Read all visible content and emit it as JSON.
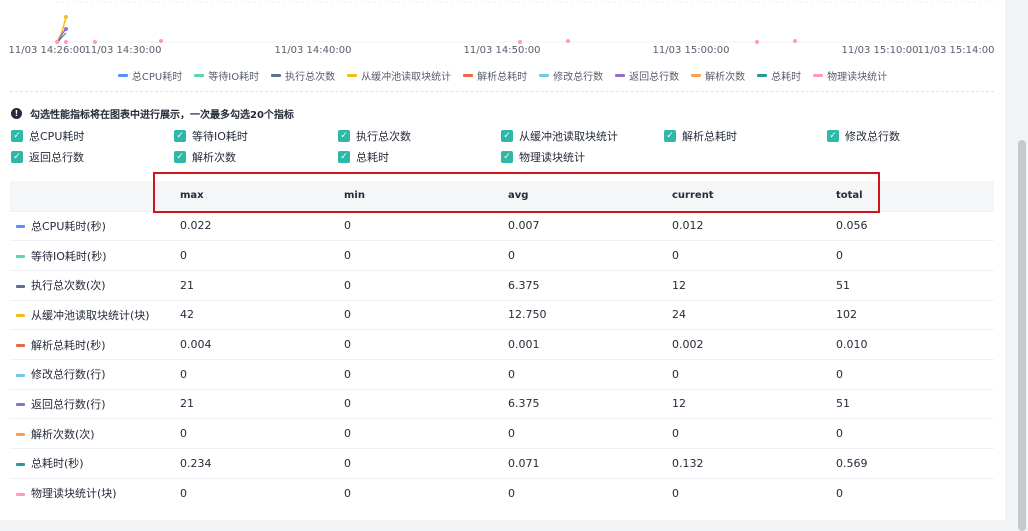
{
  "chart": {
    "x_ticks": [
      "11/03 14:26:00",
      "11/03 14:30:00",
      "11/03 14:40:00",
      "11/03 14:50:00",
      "11/03 15:00:00",
      "11/03 15:10:00",
      "11/03 15:14:00"
    ],
    "legend": [
      {
        "label": "总CPU耗时",
        "color": "#5b8ff9"
      },
      {
        "label": "等待IO耗时",
        "color": "#5ad8a6"
      },
      {
        "label": "执行总次数",
        "color": "#5d7092"
      },
      {
        "label": "从缓冲池读取块统计",
        "color": "#f6bd16"
      },
      {
        "label": "解析总耗时",
        "color": "#e8684a"
      },
      {
        "label": "修改总行数",
        "color": "#6dc8ec"
      },
      {
        "label": "返回总行数",
        "color": "#9270ca"
      },
      {
        "label": "解析次数",
        "color": "#ff9d4d"
      },
      {
        "label": "总耗时",
        "color": "#269a99"
      },
      {
        "label": "物理读块统计",
        "color": "#ff99c3"
      }
    ]
  },
  "info_text": "勾选性能指标将在图表中进行展示，一次最多勾选20个指标",
  "checkboxes": [
    "总CPU耗时",
    "等待IO耗时",
    "执行总次数",
    "从缓冲池读取块统计",
    "解析总耗时",
    "修改总行数",
    "返回总行数",
    "解析次数",
    "总耗时",
    "物理读块统计"
  ],
  "table": {
    "headers": [
      "",
      "max",
      "min",
      "avg",
      "current",
      "total"
    ],
    "rows": [
      {
        "name": "总CPU耗时(秒)",
        "color": "#5b8ff9",
        "values": [
          "0.022",
          "0",
          "0.007",
          "0.012",
          "0.056"
        ]
      },
      {
        "name": "等待IO耗时(秒)",
        "color": "#5ad8a6",
        "values": [
          "0",
          "0",
          "0",
          "0",
          "0"
        ]
      },
      {
        "name": "执行总次数(次)",
        "color": "#5d7092",
        "values": [
          "21",
          "0",
          "6.375",
          "12",
          "51"
        ]
      },
      {
        "name": "从缓冲池读取块统计(块)",
        "color": "#f6bd16",
        "values": [
          "42",
          "0",
          "12.750",
          "24",
          "102"
        ]
      },
      {
        "name": "解析总耗时(秒)",
        "color": "#e8684a",
        "values": [
          "0.004",
          "0",
          "0.001",
          "0.002",
          "0.010"
        ]
      },
      {
        "name": "修改总行数(行)",
        "color": "#6dc8ec",
        "values": [
          "0",
          "0",
          "0",
          "0",
          "0"
        ]
      },
      {
        "name": "返回总行数(行)",
        "color": "#9270ca",
        "values": [
          "21",
          "0",
          "6.375",
          "12",
          "51"
        ]
      },
      {
        "name": "解析次数(次)",
        "color": "#ff9d4d",
        "values": [
          "0",
          "0",
          "0",
          "0",
          "0"
        ]
      },
      {
        "name": "总耗时(秒)",
        "color": "#269a99",
        "values": [
          "0.234",
          "0",
          "0.071",
          "0.132",
          "0.569"
        ]
      },
      {
        "name": "物理读块统计(块)",
        "color": "#ff99c3",
        "values": [
          "0",
          "0",
          "0",
          "0",
          "0"
        ]
      }
    ]
  },
  "highlight_color": "#d0141c"
}
